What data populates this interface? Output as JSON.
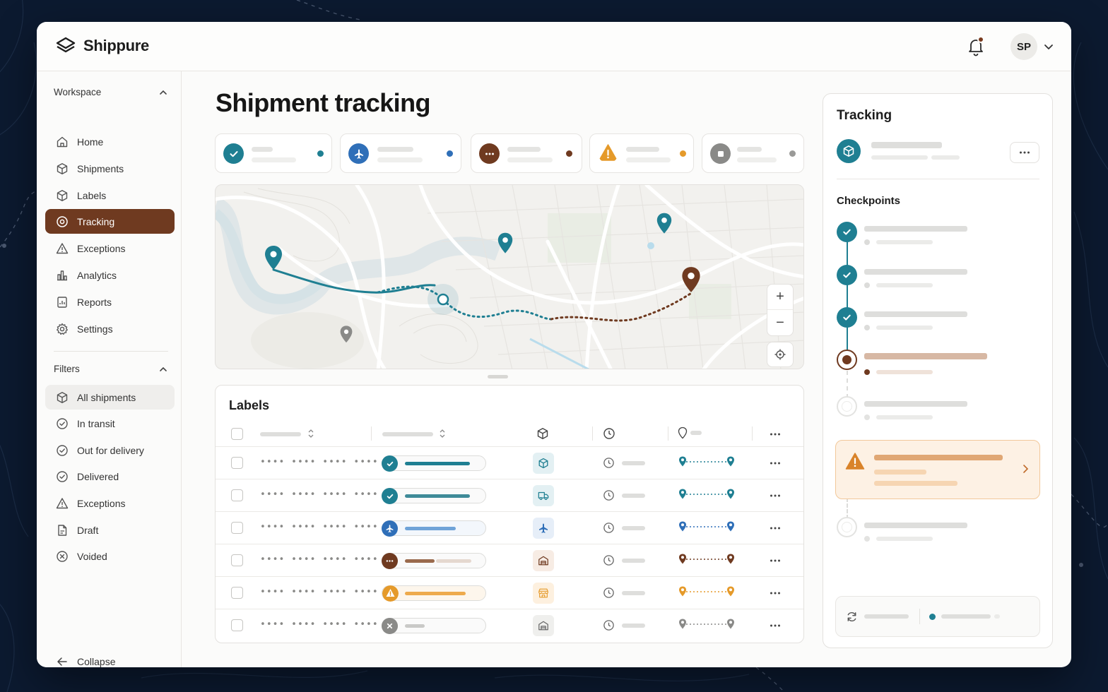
{
  "app": {
    "name": "Shippure",
    "user_initials": "SP"
  },
  "sidebar": {
    "workspace_title": "Workspace",
    "items": [
      {
        "label": "Home",
        "icon": "home-icon"
      },
      {
        "label": "Shipments",
        "icon": "box-icon"
      },
      {
        "label": "Labels",
        "icon": "box-icon"
      },
      {
        "label": "Tracking",
        "icon": "target-icon",
        "active": true
      },
      {
        "label": "Exceptions",
        "icon": "warning-icon"
      },
      {
        "label": "Analytics",
        "icon": "bar-chart-icon"
      },
      {
        "label": "Reports",
        "icon": "report-icon"
      },
      {
        "label": "Settings",
        "icon": "gear-icon"
      }
    ],
    "filters_title": "Filters",
    "filters": [
      {
        "label": "All shipments",
        "icon": "box-icon",
        "selected": true
      },
      {
        "label": "In transit",
        "icon": "check-circle-icon"
      },
      {
        "label": "Out for delivery",
        "icon": "check-circle-icon"
      },
      {
        "label": "Delivered",
        "icon": "check-circle-icon"
      },
      {
        "label": "Exceptions",
        "icon": "warning-icon"
      },
      {
        "label": "Draft",
        "icon": "document-icon"
      },
      {
        "label": "Voided",
        "icon": "x-circle-icon"
      }
    ],
    "collapse_label": "Collapse"
  },
  "main": {
    "title": "Shipment tracking",
    "status_cards": [
      {
        "status": "delivered",
        "icon": "check-icon",
        "color": "#1f7f92"
      },
      {
        "status": "in-transit",
        "icon": "plane-icon",
        "color": "#2f6fb8"
      },
      {
        "status": "pending",
        "icon": "more-icon",
        "color": "#6f3a20"
      },
      {
        "status": "exception",
        "icon": "warning-icon",
        "color": "#e59a2a"
      },
      {
        "status": "voided",
        "icon": "stop-icon",
        "color": "#8a8a88"
      }
    ],
    "map": {
      "zoom_in": "+",
      "zoom_out": "−"
    },
    "labels": {
      "title": "Labels",
      "masked_number": "•••• •••• •••• ••••",
      "rows": [
        {
          "status": "delivered",
          "color": "#1f7f92",
          "progress": 0.9,
          "type_icon": "box-icon"
        },
        {
          "status": "delivered",
          "color": "#1f7f92",
          "progress": 0.9,
          "type_icon": "truck-icon"
        },
        {
          "status": "in-transit",
          "color": "#2f6fb8",
          "progress": 0.7,
          "type_icon": "plane-icon"
        },
        {
          "status": "pending",
          "color": "#6f3a20",
          "progress": 0.45,
          "type_icon": "warehouse-icon"
        },
        {
          "status": "exception",
          "color": "#e59a2a",
          "progress": 0.85,
          "type_icon": "store-icon"
        },
        {
          "status": "voided",
          "color": "#8a8a88",
          "progress": 0.3,
          "type_icon": "warehouse-icon"
        }
      ]
    }
  },
  "panel": {
    "title": "Tracking",
    "checkpoints_title": "Checkpoints",
    "checkpoints": [
      {
        "state": "done"
      },
      {
        "state": "done"
      },
      {
        "state": "done"
      },
      {
        "state": "current"
      },
      {
        "state": "upcoming"
      },
      {
        "state": "upcoming"
      }
    ],
    "colors": {
      "accent": "#1f7f92",
      "brand": "#6f3a20",
      "warning": "#e59a2a"
    }
  }
}
